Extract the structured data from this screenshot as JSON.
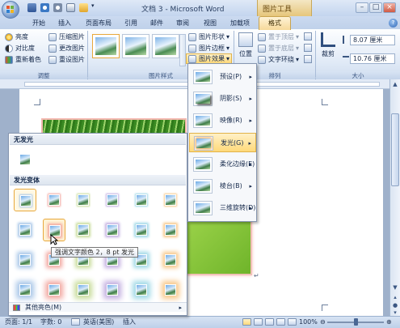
{
  "window": {
    "title": "文档 3 - Microsoft Word",
    "contextual_title": "图片工具"
  },
  "tabs": [
    "开始",
    "插入",
    "页面布局",
    "引用",
    "邮件",
    "审阅",
    "视图",
    "加载项"
  ],
  "active_tab": "格式",
  "ribbon": {
    "adjust": {
      "brightness": "亮度",
      "contrast": "对比度",
      "recolor": "重新着色",
      "compress": "压缩图片",
      "change": "更改图片",
      "reset": "重设图片",
      "group": "调整"
    },
    "styles": {
      "shape": "图片形状",
      "border": "图片边框",
      "effects": "图片效果",
      "group": "图片样式"
    },
    "arrange": {
      "position": "位置",
      "bring_front": "置于顶层",
      "send_back": "置于底层",
      "text_wrap": "文字环绕",
      "group": "排列"
    },
    "size": {
      "crop": "裁剪",
      "height": "8.07 厘米",
      "width": "10.76 厘米",
      "group": "大小"
    }
  },
  "effects_menu": [
    {
      "label": "预设(P)"
    },
    {
      "label": "阴影(S)"
    },
    {
      "label": "映像(R)"
    },
    {
      "label": "发光(G)"
    },
    {
      "label": "柔化边缘(E)"
    },
    {
      "label": "棱台(B)"
    },
    {
      "label": "三维旋转(D)"
    }
  ],
  "glow_panel": {
    "no_glow_header": "无发光",
    "variants_header": "发光变体",
    "glow_colors": [
      "#a8c6e8",
      "#f2a7a0",
      "#c8dc9a",
      "#c2aee0",
      "#9fd8e6",
      "#f8c88a"
    ],
    "tooltip": "强调文字颜色 2，8 pt 发光",
    "more_colors": "其他亮色(M)"
  },
  "statusbar": {
    "page": "页面: 1/1",
    "words": "字数: 0",
    "language": "英语(美国)",
    "insert": "插入",
    "zoom": "100%"
  }
}
